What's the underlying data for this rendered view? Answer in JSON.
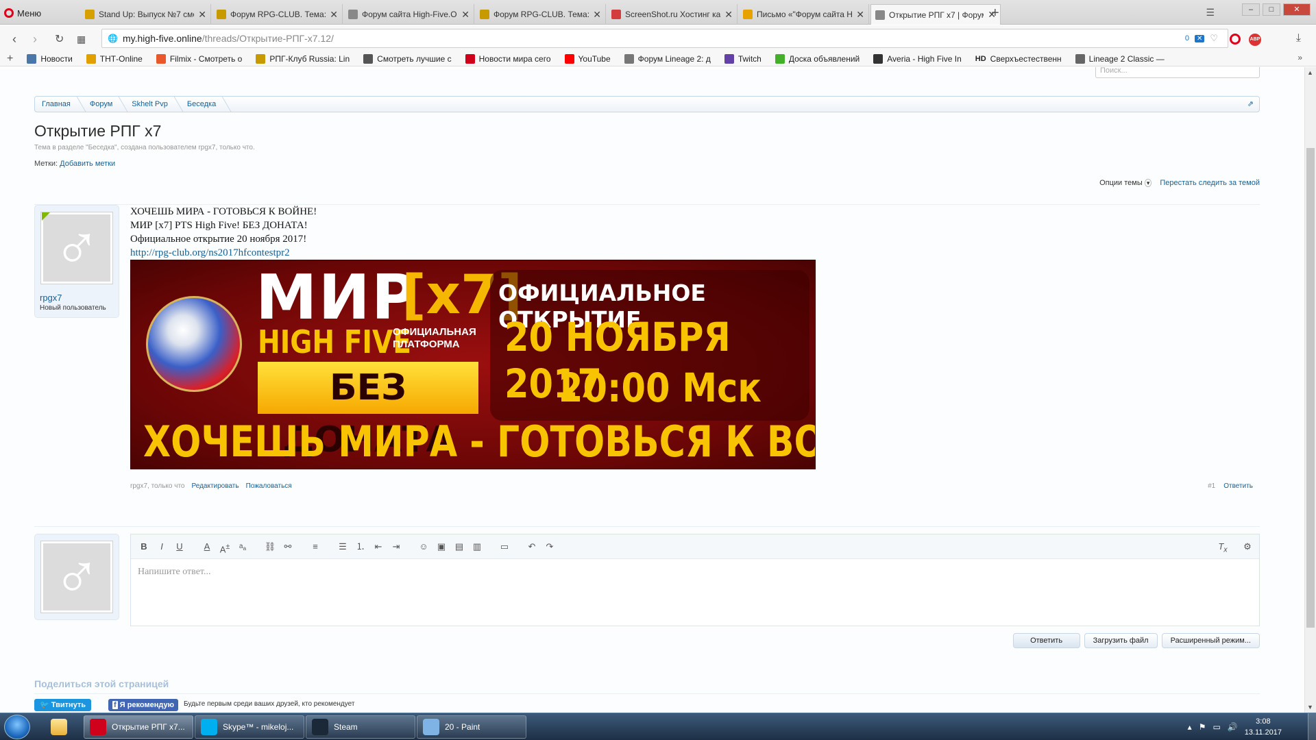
{
  "browser": {
    "menu_label": "Меню",
    "tabs": [
      {
        "title": "Stand Up: Выпуск №7 смо",
        "color": "#d6a000"
      },
      {
        "title": "Форум RPG-CLUB. Тема: H",
        "color": "#c79a00"
      },
      {
        "title": "Форум сайта High-Five.O",
        "color": "#888888"
      },
      {
        "title": "Форум RPG-CLUB. Тема: F",
        "color": "#c79a00"
      },
      {
        "title": "ScreenShot.ru Хостинг кар",
        "color": "#d23c3c"
      },
      {
        "title": "Письмо «\"Форум сайта H",
        "color": "#e8a200"
      },
      {
        "title": "Открытие РПГ x7 | Форум",
        "color": "#888888",
        "active": true
      }
    ],
    "url_host": "my.high-five.online",
    "url_path": "/threads/Открытие-РПГ-x7.12/",
    "url_prefix": "",
    "badge_count": "0",
    "bookmarks": [
      {
        "label": "Новости",
        "color": "#4a76a8"
      },
      {
        "label": "ТНТ-Online",
        "color": "#e0a000"
      },
      {
        "label": "Filmix - Смотреть о",
        "color": "#e8582a"
      },
      {
        "label": "РПГ-Клуб Russia: Lin",
        "color": "#c79a00"
      },
      {
        "label": "Смотреть лучшие с",
        "color": "#555555"
      },
      {
        "label": "Новости мира сего",
        "color": "#d0021b"
      },
      {
        "label": "YouTube",
        "color": "#ff0000"
      },
      {
        "label": "Форум Lineage 2: д",
        "color": "#777777"
      },
      {
        "label": "Twitch",
        "color": "#6441a4"
      },
      {
        "label": "Доска объявлений",
        "color": "#43b02a"
      },
      {
        "label": "Averia - High Five In",
        "color": "#333333"
      },
      {
        "label": "Сверхъестественн",
        "color": "#000000",
        "prefix": "HD"
      },
      {
        "label": "Lineage 2 Classic —",
        "color": "#666666"
      }
    ]
  },
  "forum": {
    "search_placeholder": "Поиск...",
    "breadcrumb": [
      "Главная",
      "Форум",
      "Skhelt Pvp",
      "Беседка"
    ],
    "thread_title": "Открытие РПГ х7",
    "thread_meta": "Тема в разделе \"Беседка\", создана пользователем rpgx7, только что.",
    "tags_label": "Метки:",
    "tags_add": "Добавить метки",
    "thread_options": "Опции темы",
    "unwatch": "Перестать следить за темой"
  },
  "post": {
    "username": "rpgx7",
    "user_role": "Новый пользователь",
    "lines": [
      "ХОЧЕШЬ МИРА - ГОТОВЬСЯ К ВОЙНЕ!",
      "МИР [x7] PTS High Five! БЕЗ ДОНАТА!",
      "Официальное открытие 20 ноября 2017!"
    ],
    "link": "http://rpg-club.org/ns2017hfcontestpr2",
    "banner": {
      "mir": "МИР",
      "x7": "[x7]",
      "high_five": "HIGH FIVE",
      "platform_line1": "ОФИЦИАЛЬНАЯ",
      "platform_line2": "ПЛАТФОРМА",
      "no_donate": "БЕЗ ДОНАТА",
      "official_opening": "ОФИЦИАЛЬНОЕ ОТКРЫТИЕ",
      "date": "20 НОЯБРЯ 2017",
      "time": "20:00 Мск",
      "slogan": "ХОЧЕШЬ МИРА - ГОТОВЬСЯ К ВОЙНЕ"
    },
    "meta_author": "rpgx7, только что",
    "edit": "Редактировать",
    "report": "Пожаловаться",
    "number": "#1",
    "reply": "Ответить"
  },
  "editor": {
    "placeholder": "Напишите ответ...",
    "submit": "Ответить",
    "upload": "Загрузить файл",
    "advanced": "Расширенный режим..."
  },
  "share": {
    "title": "Поделиться этой страницей",
    "tweet": "Твитнуть",
    "fb": "Я рекомендую",
    "fb_text": "Будьте первым среди ваших друзей, кто рекомендует"
  },
  "taskbar": {
    "items": [
      {
        "label": "Открытие РПГ x7...",
        "color": "#d0021b",
        "active": true
      },
      {
        "label": "Skype™ - mikeloj...",
        "color": "#00aff0"
      },
      {
        "label": "Steam",
        "color": "#1b2838"
      },
      {
        "label": "20 - Paint",
        "color": "#7fb2e5"
      }
    ],
    "time": "3:08",
    "date": "13.11.2017"
  }
}
